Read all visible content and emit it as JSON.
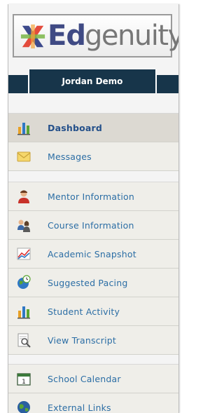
{
  "brand": {
    "prefix": "Ed",
    "suffix": "genuity"
  },
  "user": {
    "name": "Jordan Demo"
  },
  "nav": {
    "groups": [
      {
        "items": [
          {
            "label": "Dashboard",
            "icon": "dashboard-icon",
            "active": true
          },
          {
            "label": "Messages",
            "icon": "envelope-icon",
            "active": false
          }
        ]
      },
      {
        "items": [
          {
            "label": "Mentor Information",
            "icon": "mentor-person-icon"
          },
          {
            "label": "Course Information",
            "icon": "two-people-icon"
          },
          {
            "label": "Academic Snapshot",
            "icon": "line-chart-icon"
          },
          {
            "label": "Suggested Pacing",
            "icon": "globe-clock-icon"
          },
          {
            "label": "Student Activity",
            "icon": "bar-chart-icon"
          },
          {
            "label": "View Transcript",
            "icon": "magnifier-document-icon"
          }
        ]
      },
      {
        "items": [
          {
            "label": "School Calendar",
            "icon": "calendar-icon"
          },
          {
            "label": "External Links",
            "icon": "globe-icon"
          }
        ]
      }
    ]
  },
  "colors": {
    "accent": "#17354a",
    "link": "#2c6ea5",
    "logo_blue": "#3f4a84",
    "logo_gray": "#777777"
  }
}
